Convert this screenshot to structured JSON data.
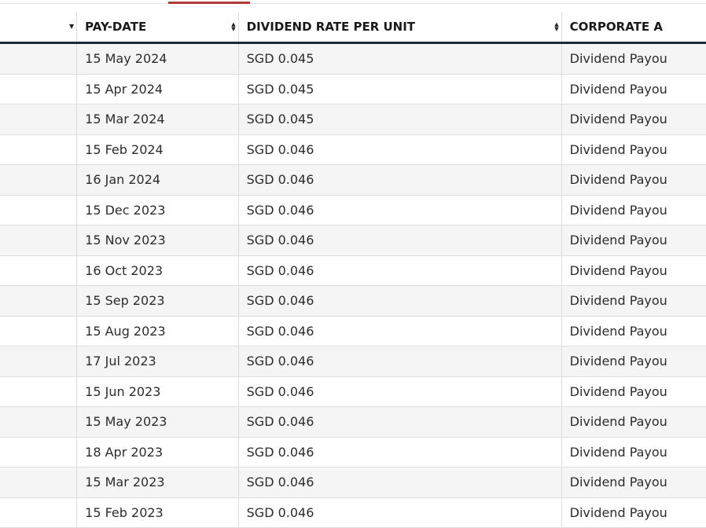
{
  "table": {
    "headers": [
      {
        "label": "",
        "sort": "down"
      },
      {
        "label": "PAY-DATE",
        "sort": "both"
      },
      {
        "label": "DIVIDEND RATE PER UNIT",
        "sort": "both"
      },
      {
        "label": "CORPORATE A",
        "sort": "none"
      }
    ],
    "rows": [
      {
        "pay_date": "15 May 2024",
        "rate": "SGD 0.045",
        "action": "Dividend Payou"
      },
      {
        "pay_date": "15 Apr 2024",
        "rate": "SGD 0.045",
        "action": "Dividend Payou"
      },
      {
        "pay_date": "15 Mar 2024",
        "rate": "SGD 0.045",
        "action": "Dividend Payou"
      },
      {
        "pay_date": "15 Feb 2024",
        "rate": "SGD 0.046",
        "action": "Dividend Payou"
      },
      {
        "pay_date": "16 Jan 2024",
        "rate": "SGD 0.046",
        "action": "Dividend Payou"
      },
      {
        "pay_date": "15 Dec 2023",
        "rate": "SGD 0.046",
        "action": "Dividend Payou"
      },
      {
        "pay_date": "15 Nov 2023",
        "rate": "SGD 0.046",
        "action": "Dividend Payou"
      },
      {
        "pay_date": "16 Oct 2023",
        "rate": "SGD 0.046",
        "action": "Dividend Payou"
      },
      {
        "pay_date": "15 Sep 2023",
        "rate": "SGD 0.046",
        "action": "Dividend Payou"
      },
      {
        "pay_date": "15 Aug 2023",
        "rate": "SGD 0.046",
        "action": "Dividend Payou"
      },
      {
        "pay_date": "17 Jul 2023",
        "rate": "SGD 0.046",
        "action": "Dividend Payou"
      },
      {
        "pay_date": "15 Jun 2023",
        "rate": "SGD 0.046",
        "action": "Dividend Payou"
      },
      {
        "pay_date": "15 May 2023",
        "rate": "SGD 0.046",
        "action": "Dividend Payou"
      },
      {
        "pay_date": "18 Apr 2023",
        "rate": "SGD 0.046",
        "action": "Dividend Payou"
      },
      {
        "pay_date": "15 Mar 2023",
        "rate": "SGD 0.046",
        "action": "Dividend Payou"
      },
      {
        "pay_date": "15 Feb 2023",
        "rate": "SGD 0.046",
        "action": "Dividend Payou"
      }
    ]
  },
  "colors": {
    "header_border": "#1c2a3e",
    "active_tab": "#b33a3a",
    "stripe": "#f5f5f5"
  }
}
